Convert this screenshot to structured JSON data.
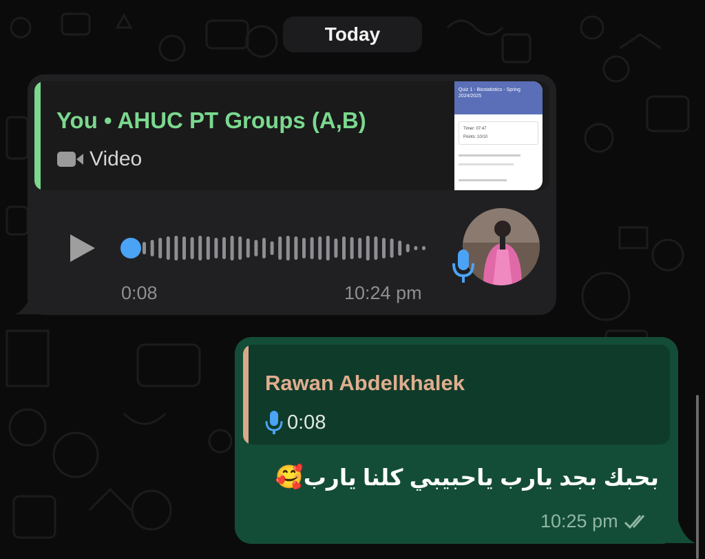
{
  "date_separator": "Today",
  "incoming": {
    "quoted_title": "You • AHUC PT Groups (A,B)",
    "quoted_media_type": "Video",
    "voice_duration": "0:08",
    "time": "10:24 pm",
    "thumbnail": {
      "line1": "Quiz 1 - Biostatistics - Spring 2024/2025",
      "timer": "Timer: 07:47",
      "points": "Points: 10/10"
    }
  },
  "outgoing": {
    "quoted_sender": "Rawan Abdelkhalek",
    "quoted_duration": "0:08",
    "text": "بحبك بجد يارب ياحبيبي كلنا يارب",
    "emoji": "🥰",
    "time": "10:25 pm",
    "status": "read"
  },
  "colors": {
    "incoming_bubble": "#202022",
    "outgoing_bubble": "#144d37",
    "accent_green": "#7bd88f",
    "quote_sender_color": "#e0ad8f",
    "play_blue": "#4ba3f5"
  },
  "icons": [
    "video-icon",
    "play-icon",
    "mic-icon",
    "double-check-icon"
  ]
}
